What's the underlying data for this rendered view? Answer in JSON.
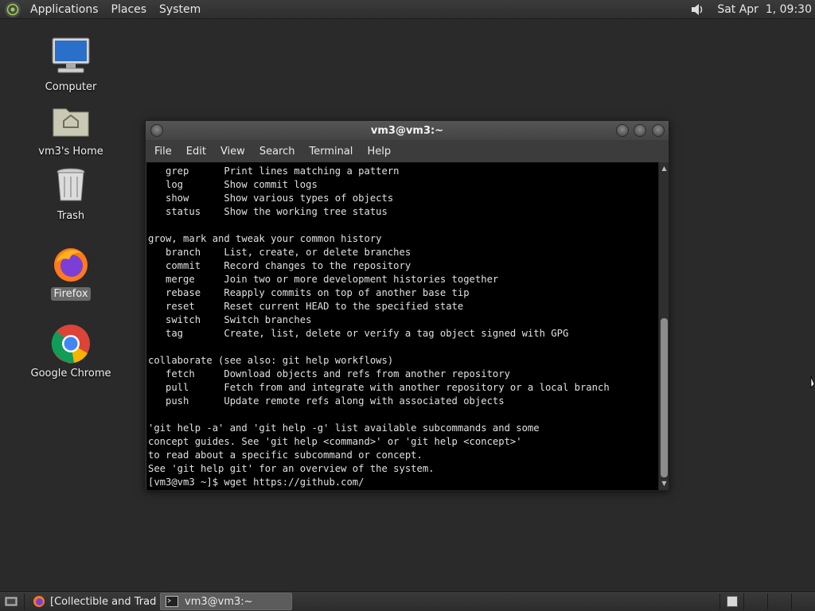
{
  "top_panel": {
    "menus": [
      "Applications",
      "Places",
      "System"
    ],
    "clock": "Sat Apr  1, 09:30"
  },
  "desktop_icons": [
    {
      "name": "Computer"
    },
    {
      "name": "vm3's Home"
    },
    {
      "name": "Trash"
    },
    {
      "name": "Firefox"
    },
    {
      "name": "Google Chrome"
    }
  ],
  "terminal": {
    "title": "vm3@vm3:~",
    "menu": [
      "File",
      "Edit",
      "View",
      "Search",
      "Terminal",
      "Help"
    ],
    "lines": [
      "   grep      Print lines matching a pattern",
      "   log       Show commit logs",
      "   show      Show various types of objects",
      "   status    Show the working tree status",
      "",
      "grow, mark and tweak your common history",
      "   branch    List, create, or delete branches",
      "   commit    Record changes to the repository",
      "   merge     Join two or more development histories together",
      "   rebase    Reapply commits on top of another base tip",
      "   reset     Reset current HEAD to the specified state",
      "   switch    Switch branches",
      "   tag       Create, list, delete or verify a tag object signed with GPG",
      "",
      "collaborate (see also: git help workflows)",
      "   fetch     Download objects and refs from another repository",
      "   pull      Fetch from and integrate with another repository or a local branch",
      "   push      Update remote refs along with associated objects",
      "",
      "'git help -a' and 'git help -g' list available subcommands and some",
      "concept guides. See 'git help <command>' or 'git help <concept>'",
      "to read about a specific subcommand or concept.",
      "See 'git help git' for an overview of the system.",
      "[vm3@vm3 ~]$ wget https://github.com/"
    ]
  },
  "taskbar": {
    "tasks": [
      "[Collectible and Trad...",
      "vm3@vm3:~"
    ]
  }
}
